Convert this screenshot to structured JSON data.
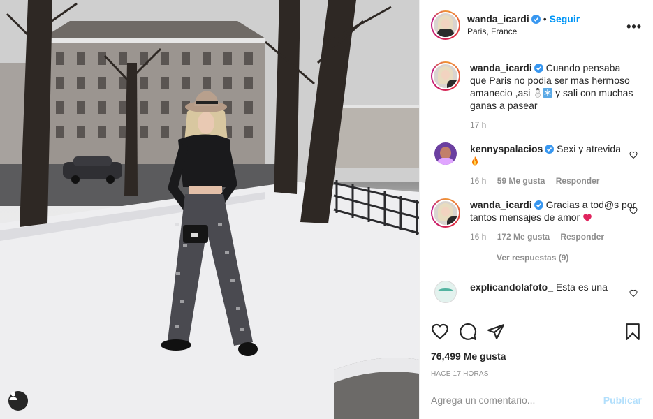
{
  "post": {
    "username": "wanda_icardi",
    "location": "Paris, France",
    "follow_label": "Seguir",
    "more_label": "•••",
    "separator": "•"
  },
  "caption": {
    "username": "wanda_icardi",
    "text_before": "Cuando pensaba que Paris no podia ser mas hermoso amanecio ,asi",
    "text_after": "y sali con muchas ganas a pasear",
    "time": "17 h"
  },
  "comments": [
    {
      "username": "kennyspalacios",
      "text": "Sexi y atrevida",
      "time": "16 h",
      "likes": "59 Me gusta",
      "reply_label": "Responder"
    },
    {
      "username": "wanda_icardi",
      "text": "Gracias a tod@s por tantos mensajes de amor",
      "time": "16 h",
      "likes": "172 Me gusta",
      "reply_label": "Responder",
      "view_replies": "Ver respuestas (9)"
    },
    {
      "username": "explicandolafoto_",
      "text": "Esta es una"
    }
  ],
  "actions": {
    "likes_count": "76,499 Me gusta",
    "posted_ago": "HACE 17 HORAS"
  },
  "composer": {
    "placeholder": "Agrega un comentario...",
    "post_label": "Publicar"
  },
  "colors": {
    "accent": "#0095f6",
    "publish_disabled": "#b2dffc",
    "heart_red": "#ed4956",
    "verified": "#3897f0"
  }
}
